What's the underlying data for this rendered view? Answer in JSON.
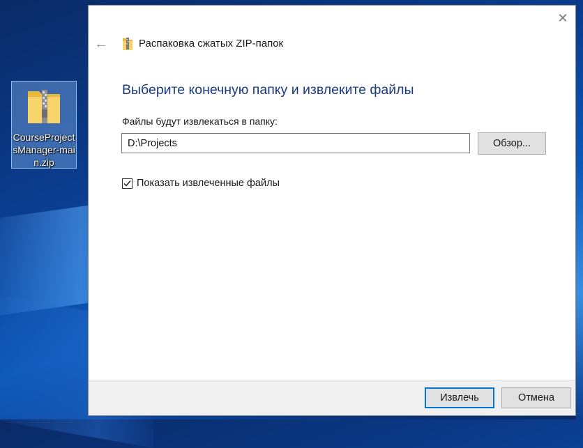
{
  "desktop": {
    "icon_label": "CourseProjectsManager-main.zip",
    "icon": "zip-folder-icon"
  },
  "dialog": {
    "title": "Распаковка сжатых ZIP-папок",
    "close_icon": "close-icon",
    "back_icon": "back-arrow-icon",
    "instruction": "Выберите конечную папку и извлеките файлы",
    "path_label": "Файлы будут извлекаться в папку:",
    "path_value": "D:\\Projects",
    "browse_label": "Обзор...",
    "show_files_label": "Показать извлеченные файлы",
    "show_files_checked": true,
    "extract_label": "Извлечь",
    "cancel_label": "Отмена"
  },
  "colors": {
    "accent": "#0078d7",
    "instruction_text": "#1a3a82",
    "desktop_bg": "#0b3d8f"
  }
}
